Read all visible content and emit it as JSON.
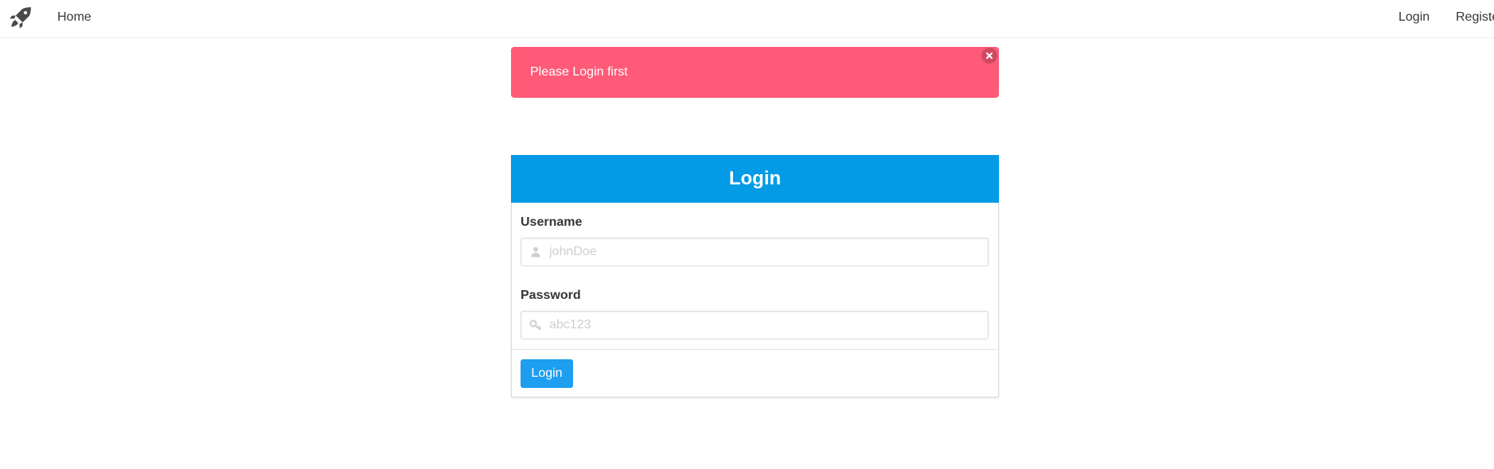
{
  "navbar": {
    "logo_icon": "rocket-icon",
    "home_label": "Home",
    "login_label": "Login",
    "register_label": "Register"
  },
  "alert": {
    "message": "Please Login first",
    "close_icon": "close-icon",
    "color": "#ff5a77"
  },
  "login_card": {
    "title": "Login",
    "header_color": "#039be5",
    "username": {
      "label": "Username",
      "placeholder": "johnDoe",
      "value": "",
      "icon": "user-icon"
    },
    "password": {
      "label": "Password",
      "placeholder": "abc123",
      "value": "",
      "icon": "key-icon"
    },
    "submit_label": "Login",
    "submit_color": "#1e9ef0"
  }
}
